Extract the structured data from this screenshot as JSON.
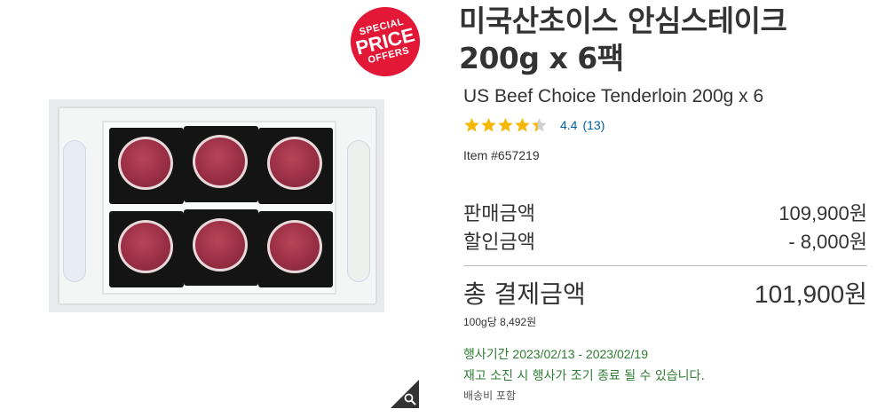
{
  "badge": {
    "line1": "SPECIAL",
    "line2": "PRICE",
    "line3": "OFFERS",
    "color": "#e31837"
  },
  "product": {
    "title_ko": "미국산초이스 안심스테이크 200g x 6팩",
    "title_en": "US Beef Choice Tenderloin 200g x 6",
    "rating": {
      "value": 4.4,
      "score_label": "4.4",
      "count_label": "(13)",
      "max": 5
    },
    "item_number": "Item #657219"
  },
  "pricing": {
    "sale_label": "판매금액",
    "sale_value": "109,900원",
    "discount_label": "할인금액",
    "discount_value": "- 8,000원",
    "total_label": "총 결제금액",
    "total_value": "101,900원",
    "unit_price": "100g당 8,492원"
  },
  "promo": {
    "period": "행사기간 2023/02/13 - 2023/02/19",
    "note": "재고 소진 시 행사가 조기 종료 될 수 있습니다.",
    "shipping": "배송비 포함",
    "color": "#2e7d32"
  },
  "icons": {
    "zoom": "magnifier-icon",
    "star": "star-icon"
  },
  "colors": {
    "star": "#f5b800",
    "star_empty": "#d0d0d0",
    "link": "#0060a9"
  }
}
